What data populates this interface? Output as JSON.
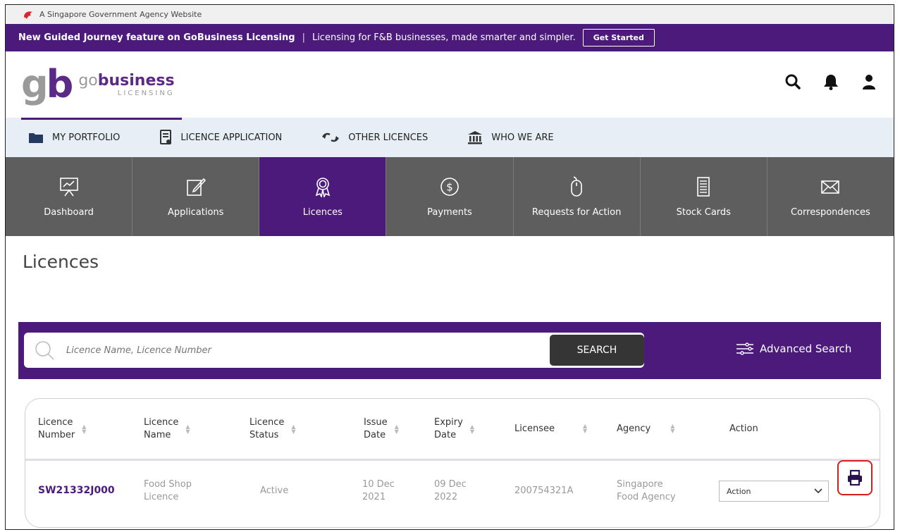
{
  "gov_banner": {
    "text": "A Singapore Government Agency Website"
  },
  "announcement": {
    "feature": "New Guided Journey feature on GoBusiness Licensing",
    "separator": "|",
    "description": "Licensing for F&B businesses, made smarter and simpler.",
    "button": "Get Started"
  },
  "brand": {
    "logo_mark": "gb",
    "name_prefix": "go",
    "name_main": "business",
    "sub": "LICENSING"
  },
  "header_icons": [
    "search-icon",
    "bell-icon",
    "user-icon"
  ],
  "top_nav": [
    {
      "label": "MY PORTFOLIO",
      "icon": "folder-icon"
    },
    {
      "label": "LICENCE APPLICATION",
      "icon": "document-icon"
    },
    {
      "label": "OTHER LICENCES",
      "icon": "exchange-icon"
    },
    {
      "label": "WHO WE ARE",
      "icon": "building-icon"
    }
  ],
  "tiles": [
    {
      "label": "Dashboard",
      "icon": "presentation-icon"
    },
    {
      "label": "Applications",
      "icon": "edit-icon"
    },
    {
      "label": "Licences",
      "icon": "award-icon",
      "active": true
    },
    {
      "label": "Payments",
      "icon": "dollar-icon"
    },
    {
      "label": "Requests for Action",
      "icon": "mouse-icon"
    },
    {
      "label": "Stock Cards",
      "icon": "stock-card-icon"
    },
    {
      "label": "Correspondences",
      "icon": "mail-icon"
    }
  ],
  "page_title": "Licences",
  "search": {
    "placeholder": "Licence Name, Licence Number",
    "button": "SEARCH",
    "advanced": "Advanced Search"
  },
  "table": {
    "headers": [
      {
        "line1": "Licence",
        "line2": "Number"
      },
      {
        "line1": "Licence",
        "line2": "Name"
      },
      {
        "line1": "Licence",
        "line2": "Status"
      },
      {
        "line1": "Issue",
        "line2": "Date"
      },
      {
        "line1": "Expiry",
        "line2": "Date"
      },
      {
        "line1": "Licensee",
        "line2": ""
      },
      {
        "line1": "Agency",
        "line2": ""
      },
      {
        "line1": "Action",
        "line2": ""
      }
    ],
    "rows": [
      {
        "number": "SW21332J000",
        "name1": "Food Shop",
        "name2": "Licence",
        "status": "Active",
        "issue1": "10 Dec",
        "issue2": "2021",
        "expiry1": "09 Dec",
        "expiry2": "2022",
        "licensee": "200754321A",
        "agency1": "Singapore",
        "agency2": "Food Agency",
        "action": "Action"
      }
    ]
  },
  "colors": {
    "primary": "#4c1a7a",
    "tile": "#5e5e5e",
    "highlight": "#d81c1c"
  }
}
